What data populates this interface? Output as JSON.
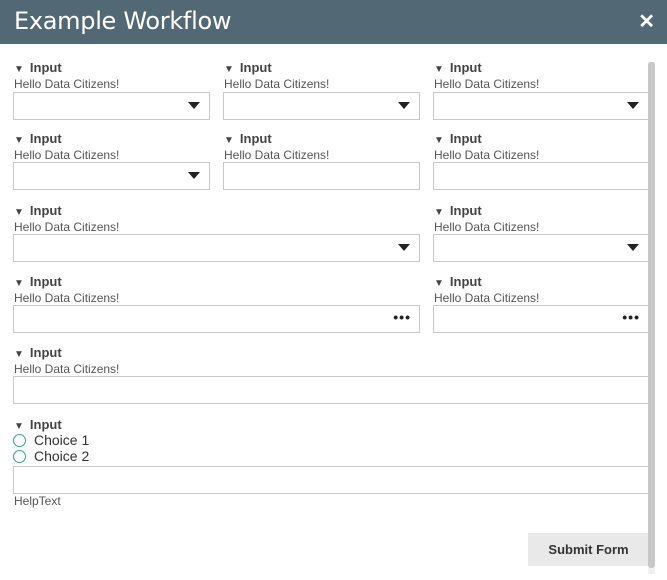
{
  "window": {
    "title": "Example Workflow",
    "close_symbol": "✕"
  },
  "fields": [
    {
      "label": "Input",
      "description": "Hello Data Citizens!"
    },
    {
      "label": "Input",
      "description": "Hello Data Citizens!"
    },
    {
      "label": "Input",
      "description": "Hello Data Citizens!"
    },
    {
      "label": "Input",
      "description": "Hello Data Citizens!"
    },
    {
      "label": "Input",
      "description": "Hello Data Citizens!"
    },
    {
      "label": "Input",
      "description": "Hello Data Citizens!"
    },
    {
      "label": "Input",
      "description": "Hello Data Citizens!"
    },
    {
      "label": "Input",
      "description": "Hello Data Citizens!"
    },
    {
      "label": "Input",
      "description": "Hello Data Citizens!"
    },
    {
      "label": "Input",
      "description": "Hello Data Citizens!"
    },
    {
      "label": "Input",
      "description": "Hello Data Citizens!"
    },
    {
      "label": "Input",
      "choices": [
        "Choice 1",
        "Choice 2"
      ],
      "help_text": "HelpText"
    }
  ],
  "icons": {
    "dropdown": "caret-down-icon",
    "expand": "triangle-down-icon",
    "more": "ellipsis-icon",
    "close": "close-icon"
  },
  "submit_label": "Submit Form",
  "colors": {
    "titlebar": "#536875",
    "radio_border": "#3c9a8a",
    "submit_bg": "#e9e9e9"
  }
}
